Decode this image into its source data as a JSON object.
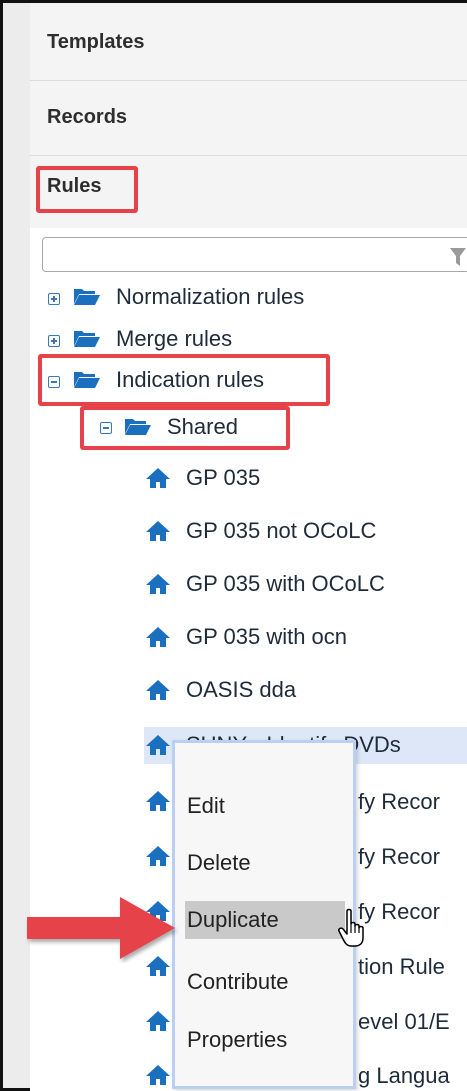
{
  "sections": {
    "templates": "Templates",
    "records": "Records",
    "rules": "Rules"
  },
  "filter": {
    "value": "",
    "placeholder": ""
  },
  "tree": {
    "normalization": "Normalization rules",
    "merge": "Merge rules",
    "indication": "Indication rules",
    "shared": "Shared",
    "rules": [
      "GP 035",
      "GP 035 not OCoLC",
      "GP 035 with OCoLC",
      "GP 035 with ocn",
      "OASIS dda",
      "SUNY - Identify DVDs"
    ],
    "partial": [
      "fy Recor",
      "fy Recor",
      "fy Recor",
      "tion Rule",
      "evel 01/E",
      "g Langua"
    ]
  },
  "context_menu": {
    "items": [
      "Edit",
      "Delete",
      "Duplicate",
      "Contribute",
      "Properties"
    ],
    "highlighted": "Duplicate"
  },
  "colors": {
    "annotation": "#e5424a",
    "icon_blue": "#1a6fbf",
    "selection": "#dde7f7"
  }
}
